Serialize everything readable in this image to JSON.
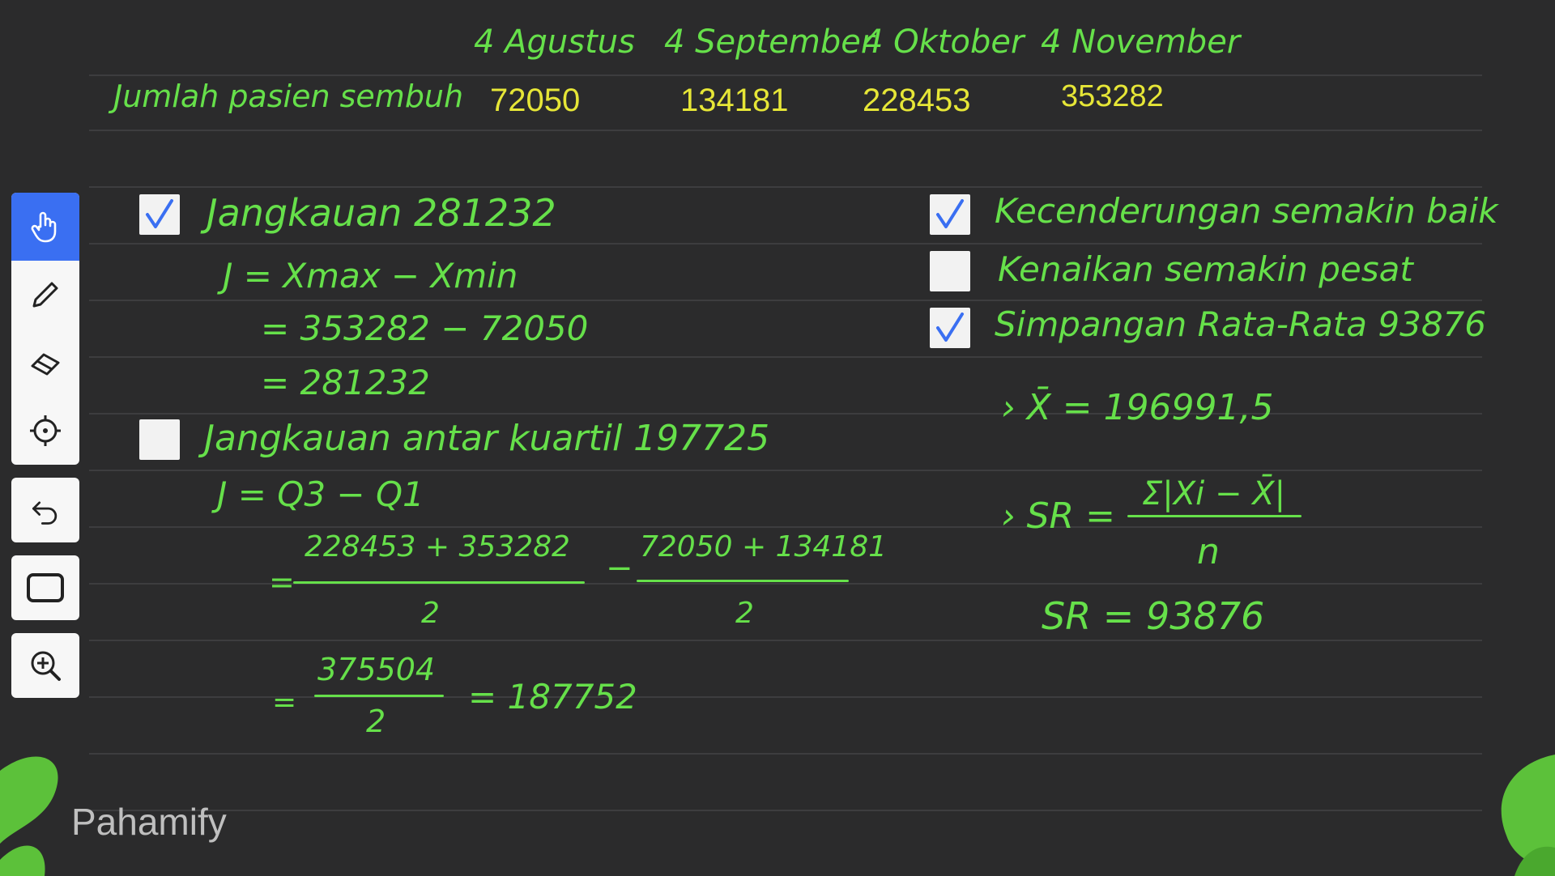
{
  "header": {
    "row_label": "Jumlah pasien sembuh",
    "dates": [
      "4 Agustus",
      "4 September",
      "4 Oktober",
      "4 November"
    ],
    "values": [
      "72050",
      "134181",
      "228453",
      "353282"
    ]
  },
  "left": {
    "item1": {
      "checked": true,
      "title": "Jangkauan 281232",
      "line1": "J = Xmax − Xmin",
      "line2": "= 353282 − 72050",
      "line3": "= 281232"
    },
    "item2": {
      "checked": false,
      "title": "Jangkauan antar kuartil 197725",
      "line1": "J = Q3 − Q1",
      "frac1_num": "228453 + 353282",
      "frac1_den": "2",
      "minus": "−",
      "frac2_num": "72050 + 134181",
      "frac2_den": "2",
      "eq1": "=",
      "frac3_num": "375504",
      "frac3_den": "2",
      "eq2": "=",
      "eq3": "= 187752"
    }
  },
  "right": {
    "item1": {
      "checked": true,
      "label": "Kecenderungan semakin baik"
    },
    "item2": {
      "checked": false,
      "label": "Kenaikan semakin pesat"
    },
    "item3": {
      "checked": true,
      "label": "Simpangan Rata-Rata 93876"
    },
    "mean": "› X̄ = 196991,5",
    "sr_lhs": "› SR =",
    "sr_num": "Σ|Xi − X̄|",
    "sr_den": "n",
    "sr_result": "SR = 93876"
  },
  "toolbar": {
    "tools": [
      "hand-tool",
      "pen-tool",
      "eraser-tool",
      "pointer-tool",
      "undo-tool",
      "rectangle-tool",
      "zoom-in-tool"
    ]
  },
  "brand": {
    "logo_text": "Pahamify"
  },
  "colors": {
    "background": "#2b2b2c",
    "ink_green": "#66e04a",
    "ink_yellow": "#e6e637",
    "check_blue": "#3a6ff2",
    "toolbar_active": "#3a6ff2"
  }
}
